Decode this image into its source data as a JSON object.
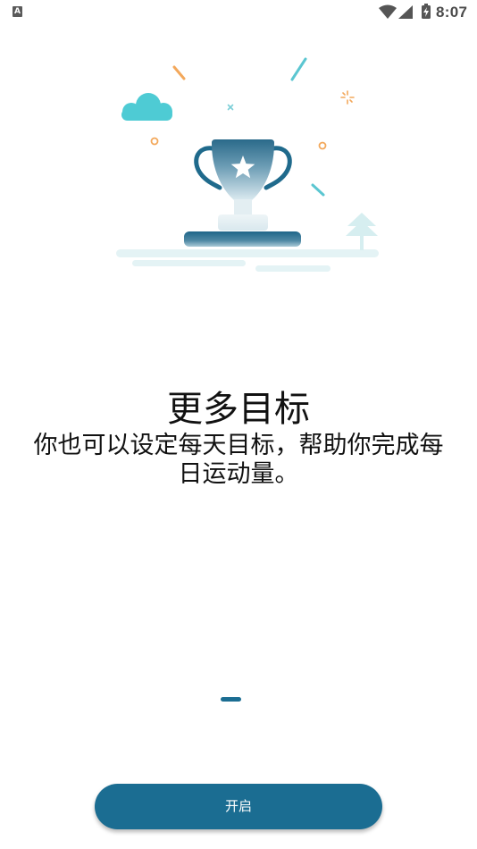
{
  "status_bar": {
    "notification_letter": "A",
    "time": "8:07",
    "icons": [
      "a-notification-icon",
      "wifi-icon",
      "signal-icon",
      "battery-charging-icon"
    ]
  },
  "illustration": {
    "icon": "trophy-icon",
    "elements": [
      "star-icon",
      "cloud-icon",
      "tree-icon",
      "confetti"
    ]
  },
  "onboarding": {
    "title": "更多目标",
    "subtitle": "你也可以设定每天目标，帮助你完成每日运动量。"
  },
  "button": {
    "label": "开启"
  },
  "colors": {
    "primary": "#1b6d92",
    "background": "#ffffff",
    "cloud": "#4ecbd4",
    "confetti_orange": "#f3a85b",
    "ground": "#e4f3f5"
  }
}
